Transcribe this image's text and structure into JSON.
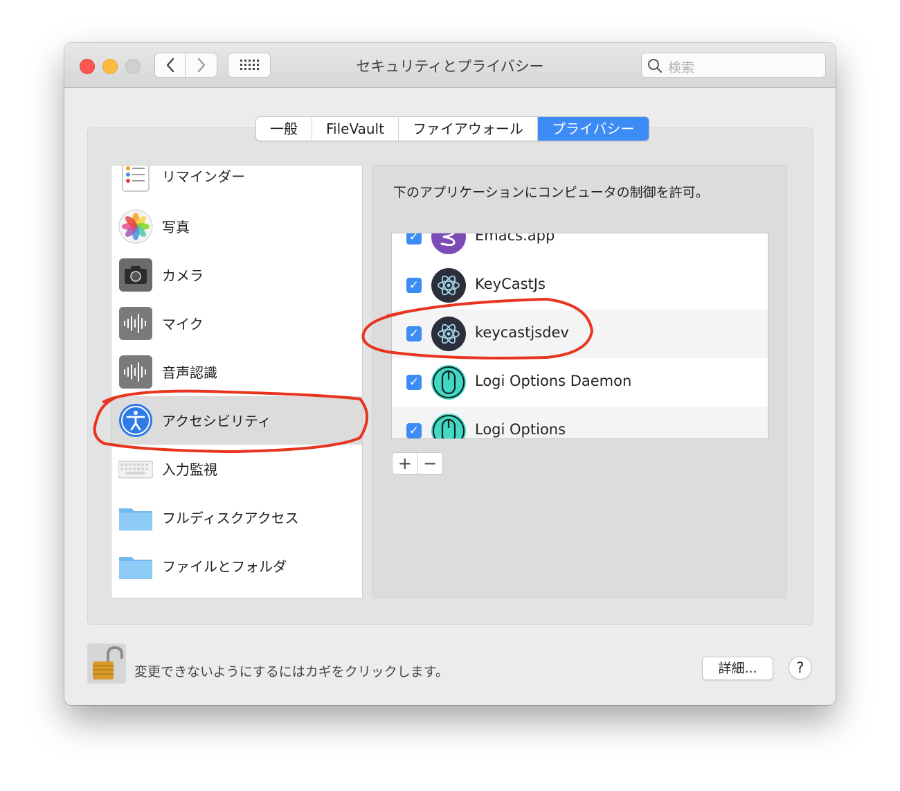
{
  "window": {
    "title": "セキュリティとプライバシー",
    "search_placeholder": "検索"
  },
  "tabs": [
    {
      "label": "一般",
      "active": false
    },
    {
      "label": "FileVault",
      "active": false
    },
    {
      "label": "ファイアウォール",
      "active": false
    },
    {
      "label": "プライバシー",
      "active": true
    }
  ],
  "sidebar": {
    "items": [
      {
        "label": "リマインダー",
        "icon": "reminders-icon"
      },
      {
        "label": "写真",
        "icon": "photos-icon"
      },
      {
        "label": "カメラ",
        "icon": "camera-icon"
      },
      {
        "label": "マイク",
        "icon": "microphone-icon"
      },
      {
        "label": "音声認識",
        "icon": "speech-recognition-icon"
      },
      {
        "label": "アクセシビリティ",
        "icon": "accessibility-icon",
        "selected": true
      },
      {
        "label": "入力監視",
        "icon": "keyboard-icon"
      },
      {
        "label": "フルディスクアクセス",
        "icon": "folder-icon"
      },
      {
        "label": "ファイルとフォルダ",
        "icon": "folder-icon"
      }
    ]
  },
  "main": {
    "description": "下のアプリケーションにコンピュータの制御を許可。",
    "apps": [
      {
        "label": "Emacs.app",
        "checked": true,
        "icon": "emacs-icon"
      },
      {
        "label": "KeyCastJs",
        "checked": true,
        "icon": "electron-icon"
      },
      {
        "label": "keycastjsdev",
        "checked": true,
        "icon": "electron-icon"
      },
      {
        "label": "Logi Options Daemon",
        "checked": true,
        "icon": "logi-mouse-icon"
      },
      {
        "label": "Logi Options",
        "checked": true,
        "icon": "logi-mouse-icon"
      }
    ],
    "add_label": "+",
    "remove_label": "−"
  },
  "footer": {
    "lock_text": "変更できないようにするにはカギをクリックします。",
    "details_label": "詳細...",
    "help_label": "?"
  },
  "colors": {
    "accent": "#3d8cf6",
    "annotation": "#e8341f"
  }
}
